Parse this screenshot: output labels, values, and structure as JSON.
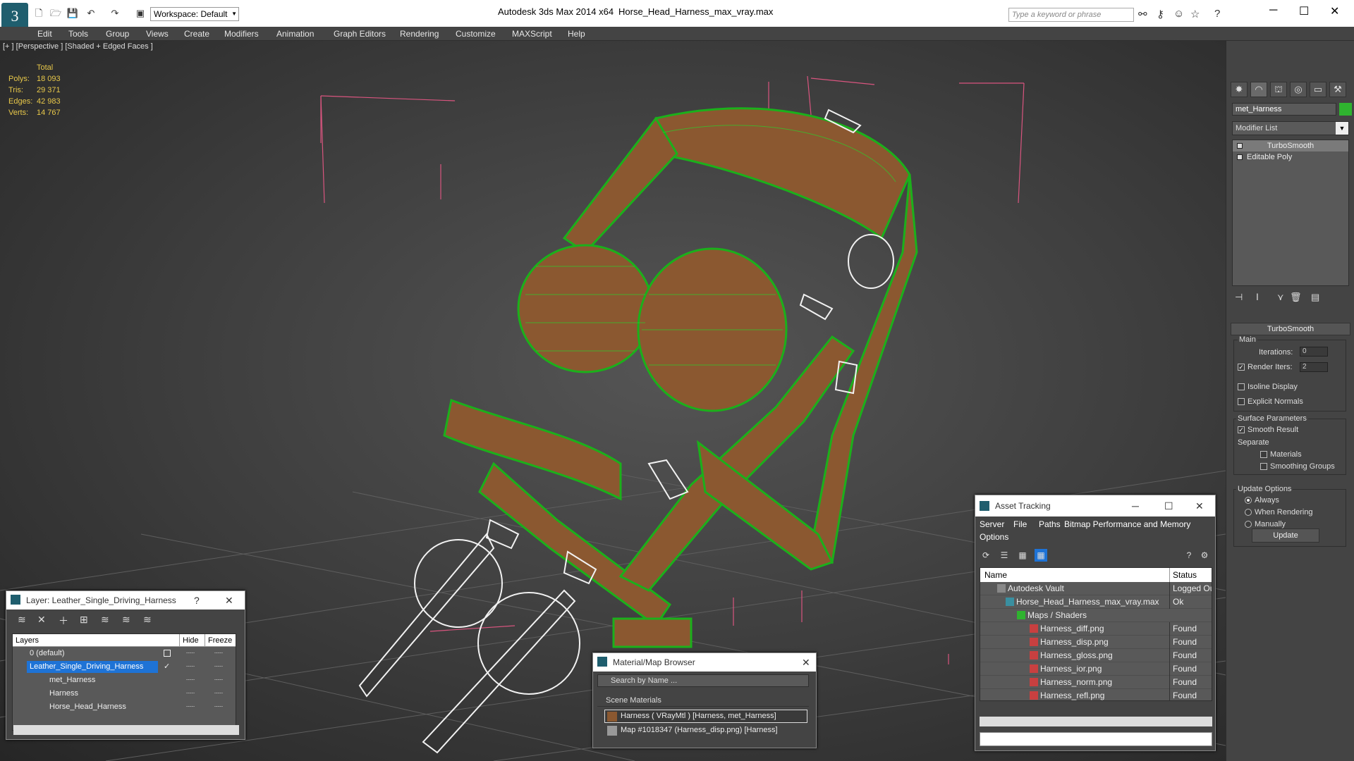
{
  "app": {
    "title": "Autodesk 3ds Max  2014 x64",
    "file": "Horse_Head_Harness_max_vray.max",
    "workspace": "Workspace: Default",
    "search_placeholder": "Type a keyword or phrase"
  },
  "menu": [
    "Edit",
    "Tools",
    "Group",
    "Views",
    "Create",
    "Modifiers",
    "Animation",
    "Graph Editors",
    "Rendering",
    "Customize",
    "MAXScript",
    "Help"
  ],
  "viewport": {
    "label": "[+ ] [Perspective ] [Shaded + Edged Faces ]",
    "stats": {
      "header": "Total",
      "rows": [
        {
          "k": "Polys:",
          "v": "18 093"
        },
        {
          "k": "Tris:",
          "v": "29 371"
        },
        {
          "k": "Edges:",
          "v": "42 983"
        },
        {
          "k": "Verts:",
          "v": "14 767"
        }
      ]
    }
  },
  "command_panel": {
    "object_name": "met_Harness",
    "object_color": "#2fb32f",
    "modifier_list": "Modifier List",
    "stack": [
      "TurboSmooth",
      "Editable Poly"
    ],
    "turbosmooth": {
      "title": "TurboSmooth",
      "main": "Main",
      "iterations_label": "Iterations:",
      "iterations": "0",
      "render_iters_label": "Render Iters:",
      "render_iters": "2",
      "isoline": "Isoline Display",
      "explicit_normals": "Explicit Normals",
      "surface_params": "Surface Parameters",
      "smooth_result": "Smooth Result",
      "separate": "Separate",
      "materials": "Materials",
      "smoothing_groups": "Smoothing Groups",
      "update_options": "Update Options",
      "always": "Always",
      "when_rendering": "When Rendering",
      "manually": "Manually",
      "update_btn": "Update"
    }
  },
  "layers": {
    "title": "Layer: Leather_Single_Driving_Harness",
    "help": "?",
    "col_layers": "Layers",
    "col_hide": "Hide",
    "col_freeze": "Freeze",
    "rows": [
      "0 (default)",
      "Leather_Single_Driving_Harness",
      "met_Harness",
      "Harness",
      "Horse_Head_Harness"
    ]
  },
  "material_browser": {
    "title": "Material/Map Browser",
    "search": "Search by Name ...",
    "section": "Scene Materials",
    "items": [
      "Harness  ( VRayMtl )  [Harness, met_Harness]",
      "Map #1018347 (Harness_disp.png)  [Harness]"
    ]
  },
  "asset_tracking": {
    "title": "Asset Tracking",
    "menu": [
      "Server",
      "File",
      "Paths",
      "Bitmap Performance and Memory",
      "Options"
    ],
    "col_name": "Name",
    "col_status": "Status",
    "rows": [
      {
        "name": "Autodesk Vault",
        "status": "Logged Ou"
      },
      {
        "name": "Horse_Head_Harness_max_vray.max",
        "status": "Ok"
      },
      {
        "name": "Maps / Shaders",
        "status": ""
      },
      {
        "name": "Harness_diff.png",
        "status": "Found"
      },
      {
        "name": "Harness_disp.png",
        "status": "Found"
      },
      {
        "name": "Harness_gloss.png",
        "status": "Found"
      },
      {
        "name": "Harness_ior.png",
        "status": "Found"
      },
      {
        "name": "Harness_norm.png",
        "status": "Found"
      },
      {
        "name": "Harness_refl.png",
        "status": "Found"
      }
    ]
  }
}
